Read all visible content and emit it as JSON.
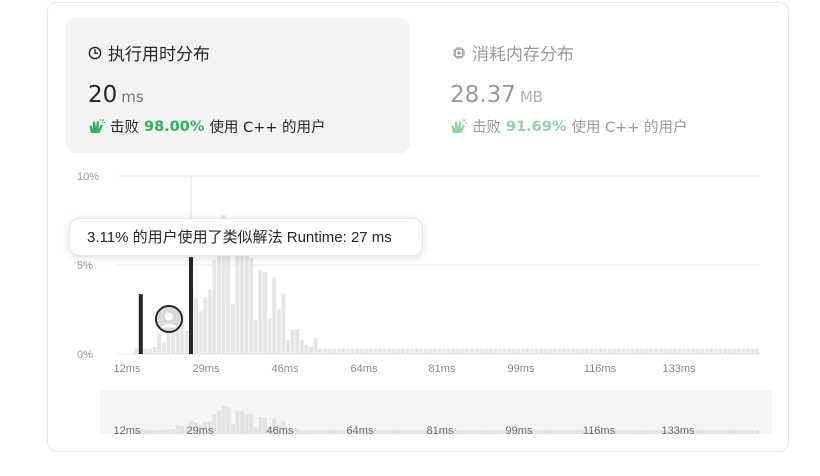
{
  "runtime_tab": {
    "icon": "clock-icon",
    "title": "执行用时分布",
    "value": "20",
    "unit": "ms",
    "beat_prefix": "击败",
    "beat_percent": "98.00%",
    "beat_suffix": "使用 C++ 的用户"
  },
  "memory_tab": {
    "icon": "chip-icon",
    "title": "消耗内存分布",
    "value": "28.37",
    "unit": "MB",
    "beat_prefix": "击败",
    "beat_percent": "91.69%",
    "beat_suffix": "使用 C++ 的用户"
  },
  "tooltip": {
    "text": "3.11% 的用户使用了类似解法 Runtime: 27 ms"
  },
  "colors": {
    "accent_green": "#2db55d",
    "bar_gray": "#e6e6e6",
    "bar_selected": "#262626"
  },
  "chart_data": {
    "type": "bar",
    "title": "",
    "xlabel": "",
    "ylabel": "",
    "y_ticks": [
      "10%",
      "5%",
      "0%"
    ],
    "ylim": [
      0,
      10
    ],
    "x_ticks": [
      "12ms",
      "29ms",
      "46ms",
      "64ms",
      "81ms",
      "99ms",
      "116ms",
      "133ms"
    ],
    "your_runtime_ms": 20,
    "hover_runtime_ms": 27,
    "bars": [
      {
        "x": 14,
        "v": 0.3
      },
      {
        "x": 15,
        "v": 0.3
      },
      {
        "x": 16,
        "v": 0.3
      },
      {
        "x": 17,
        "v": 0.3
      },
      {
        "x": 18,
        "v": 0.4
      },
      {
        "x": 19,
        "v": 1.2
      },
      {
        "x": 20,
        "v": 0.6
      },
      {
        "x": 21,
        "v": 1.3
      },
      {
        "x": 22,
        "v": 1.3
      },
      {
        "x": 23,
        "v": 2.4
      },
      {
        "x": 24,
        "v": 2.2
      },
      {
        "x": 25,
        "v": 1.3
      },
      {
        "x": 26,
        "v": 3.7
      },
      {
        "x": 27,
        "v": 3.11
      },
      {
        "x": 28,
        "v": 2.4
      },
      {
        "x": 29,
        "v": 3.2
      },
      {
        "x": 30,
        "v": 3.6
      },
      {
        "x": 31,
        "v": 5.3
      },
      {
        "x": 32,
        "v": 6.5
      },
      {
        "x": 33,
        "v": 7.8
      },
      {
        "x": 34,
        "v": 7.4
      },
      {
        "x": 35,
        "v": 2.8
      },
      {
        "x": 36,
        "v": 6.3
      },
      {
        "x": 37,
        "v": 6.4
      },
      {
        "x": 38,
        "v": 5.6
      },
      {
        "x": 39,
        "v": 5.4
      },
      {
        "x": 40,
        "v": 1.9
      },
      {
        "x": 41,
        "v": 4.7
      },
      {
        "x": 42,
        "v": 4.6
      },
      {
        "x": 43,
        "v": 2.0
      },
      {
        "x": 44,
        "v": 4.3
      },
      {
        "x": 45,
        "v": 2.5
      },
      {
        "x": 46,
        "v": 3.4
      },
      {
        "x": 47,
        "v": 0.8
      },
      {
        "x": 48,
        "v": 1.4
      },
      {
        "x": 49,
        "v": 1.4
      },
      {
        "x": 50,
        "v": 0.8
      },
      {
        "x": 51,
        "v": 0.5
      },
      {
        "x": 52,
        "v": 0.4
      },
      {
        "x": 53,
        "v": 0.9
      },
      {
        "x": 54,
        "v": 0.3
      },
      {
        "x": 55,
        "v": 0.3
      },
      {
        "x": 56,
        "v": 0.3
      },
      {
        "x": 57,
        "v": 0.3
      },
      {
        "x": 58,
        "v": 0.3
      },
      {
        "x": 59,
        "v": 0.3
      },
      {
        "x": 60,
        "v": 0.3
      },
      {
        "x": 61,
        "v": 0.3
      },
      {
        "x": 62,
        "v": 0.3
      },
      {
        "x": 63,
        "v": 0.3
      },
      {
        "x": 64,
        "v": 0.3
      },
      {
        "x": 65,
        "v": 0.3
      },
      {
        "x": 66,
        "v": 0.3
      },
      {
        "x": 67,
        "v": 0.3
      },
      {
        "x": 68,
        "v": 0.3
      },
      {
        "x": 69,
        "v": 0.3
      },
      {
        "x": 70,
        "v": 0.3
      },
      {
        "x": 71,
        "v": 0.3
      },
      {
        "x": 72,
        "v": 0.3
      },
      {
        "x": 73,
        "v": 0.3
      },
      {
        "x": 74,
        "v": 0.3
      },
      {
        "x": 75,
        "v": 0.3
      },
      {
        "x": 76,
        "v": 0.3
      },
      {
        "x": 77,
        "v": 0.3
      },
      {
        "x": 78,
        "v": 0.3
      },
      {
        "x": 79,
        "v": 0.3
      },
      {
        "x": 80,
        "v": 0.3
      },
      {
        "x": 81,
        "v": 0.3
      },
      {
        "x": 82,
        "v": 0.3
      },
      {
        "x": 83,
        "v": 0.3
      },
      {
        "x": 84,
        "v": 0.3
      },
      {
        "x": 85,
        "v": 0.3
      },
      {
        "x": 86,
        "v": 0.3
      },
      {
        "x": 87,
        "v": 0.3
      },
      {
        "x": 88,
        "v": 0.3
      },
      {
        "x": 89,
        "v": 0.3
      },
      {
        "x": 90,
        "v": 0.3
      },
      {
        "x": 91,
        "v": 0.3
      },
      {
        "x": 92,
        "v": 0.3
      },
      {
        "x": 93,
        "v": 0.3
      },
      {
        "x": 94,
        "v": 0.3
      },
      {
        "x": 95,
        "v": 0.3
      },
      {
        "x": 96,
        "v": 0.3
      },
      {
        "x": 97,
        "v": 0.3
      },
      {
        "x": 98,
        "v": 0.3
      },
      {
        "x": 99,
        "v": 0.3
      },
      {
        "x": 100,
        "v": 0.3
      },
      {
        "x": 101,
        "v": 0.3
      },
      {
        "x": 102,
        "v": 0.3
      },
      {
        "x": 103,
        "v": 0.3
      },
      {
        "x": 104,
        "v": 0.3
      },
      {
        "x": 105,
        "v": 0.3
      },
      {
        "x": 106,
        "v": 0.3
      },
      {
        "x": 107,
        "v": 0.3
      },
      {
        "x": 108,
        "v": 0.3
      },
      {
        "x": 109,
        "v": 0.3
      },
      {
        "x": 110,
        "v": 0.3
      },
      {
        "x": 111,
        "v": 0.3
      },
      {
        "x": 112,
        "v": 0.3
      },
      {
        "x": 113,
        "v": 0.3
      },
      {
        "x": 114,
        "v": 0.3
      },
      {
        "x": 115,
        "v": 0.3
      },
      {
        "x": 116,
        "v": 0.3
      },
      {
        "x": 117,
        "v": 0.3
      },
      {
        "x": 118,
        "v": 0.3
      },
      {
        "x": 119,
        "v": 0.3
      },
      {
        "x": 120,
        "v": 0.3
      },
      {
        "x": 121,
        "v": 0.3
      },
      {
        "x": 122,
        "v": 0.3
      },
      {
        "x": 123,
        "v": 0.3
      },
      {
        "x": 124,
        "v": 0.3
      },
      {
        "x": 125,
        "v": 0.3
      },
      {
        "x": 126,
        "v": 0.3
      },
      {
        "x": 127,
        "v": 0.3
      },
      {
        "x": 128,
        "v": 0.3
      },
      {
        "x": 129,
        "v": 0.3
      },
      {
        "x": 130,
        "v": 0.3
      },
      {
        "x": 131,
        "v": 0.3
      },
      {
        "x": 132,
        "v": 0.3
      },
      {
        "x": 133,
        "v": 0.3
      },
      {
        "x": 134,
        "v": 0.3
      },
      {
        "x": 135,
        "v": 0.3
      },
      {
        "x": 136,
        "v": 0.3
      },
      {
        "x": 137,
        "v": 0.3
      },
      {
        "x": 138,
        "v": 0.3
      },
      {
        "x": 139,
        "v": 0.3
      },
      {
        "x": 140,
        "v": 0.3
      },
      {
        "x": 141,
        "v": 0.3
      },
      {
        "x": 142,
        "v": 0.3
      },
      {
        "x": 143,
        "v": 0.3
      },
      {
        "x": 144,
        "v": 0.3
      },
      {
        "x": 145,
        "v": 0.3
      },
      {
        "x": 146,
        "v": 0.3
      },
      {
        "x": 147,
        "v": 0.3
      },
      {
        "x": 148,
        "v": 0.3
      },
      {
        "x": 149,
        "v": 0.3
      }
    ]
  }
}
